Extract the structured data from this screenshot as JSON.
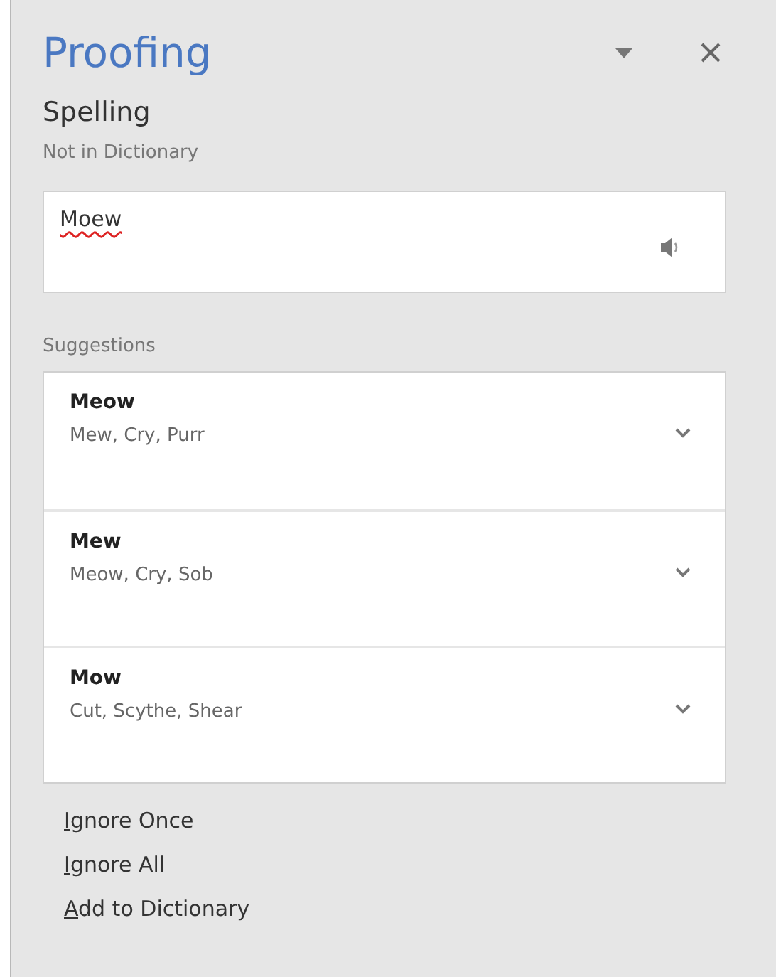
{
  "pane": {
    "title": "Proofing"
  },
  "section": {
    "heading": "Spelling",
    "error_type": "Not in Dictionary"
  },
  "word": {
    "text": "Moew",
    "misspelled": true
  },
  "suggestions_label": "Suggestions",
  "suggestions": [
    {
      "word": "Meow",
      "synonyms": "Mew, Cry, Purr",
      "expanded": false
    },
    {
      "word": "Mew",
      "synonyms": "Meow, Cry, Sob",
      "expanded": false
    },
    {
      "word": "Mow",
      "synonyms": "Cut, Scythe, Shear",
      "expanded": false
    }
  ],
  "actions": [
    "Ignore Once",
    "Ignore All",
    "Add to Dictionary"
  ]
}
